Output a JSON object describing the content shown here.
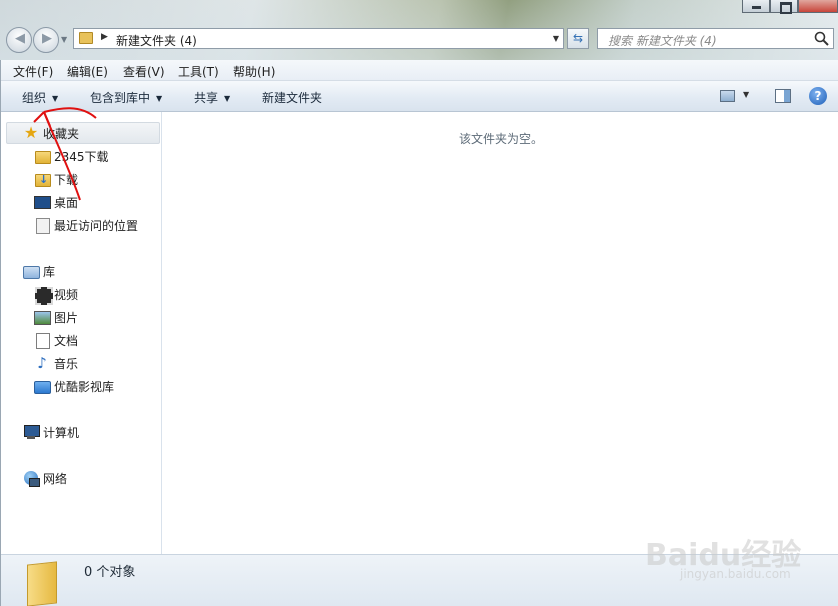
{
  "window": {
    "minimize_icon": "minimize-icon",
    "maximize_icon": "maximize-icon",
    "close_icon": "close-icon"
  },
  "nav": {
    "back_icon": "back-arrow-icon",
    "forward_icon": "forward-arrow-icon",
    "address_path": "新建文件夹 (4)",
    "search_placeholder": "搜索 新建文件夹 (4)"
  },
  "menu": [
    "文件(F)",
    "编辑(E)",
    "查看(V)",
    "工具(T)",
    "帮助(H)"
  ],
  "toolbar": {
    "organize": "组织",
    "include_in_library": "包含到库中",
    "share": "共享",
    "new_folder": "新建文件夹",
    "help_label": "?"
  },
  "sidebar": {
    "favorites": "收藏夹",
    "fav_items": [
      "2345下载",
      "下载",
      "桌面",
      "最近访问的位置"
    ],
    "libraries": "库",
    "lib_items": [
      "视频",
      "图片",
      "文档",
      "音乐",
      "优酷影视库"
    ],
    "computer": "计算机",
    "network": "网络"
  },
  "content": {
    "empty_message": "该文件夹为空。"
  },
  "status": {
    "item_count": "0 个对象"
  },
  "watermark": {
    "main": "Baidu经验",
    "sub": "jingyan.baidu.com"
  },
  "annotation_color": "#e01010"
}
